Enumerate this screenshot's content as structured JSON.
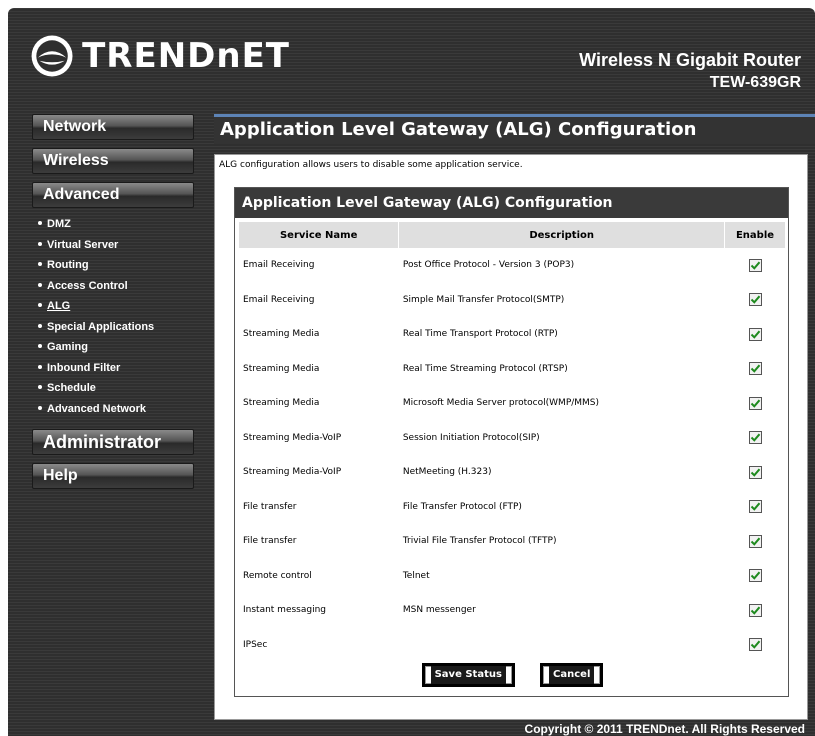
{
  "header": {
    "brand": "TRENDnET",
    "product": "Wireless N Gigabit Router",
    "model": "TEW-639GR"
  },
  "sidebar": {
    "network": "Network",
    "wireless": "Wireless",
    "advanced": "Advanced",
    "sub_items": [
      {
        "label": "DMZ"
      },
      {
        "label": "Virtual Server"
      },
      {
        "label": "Routing"
      },
      {
        "label": "Access Control"
      },
      {
        "label": "ALG"
      },
      {
        "label": "Special Applications"
      },
      {
        "label": "Gaming"
      },
      {
        "label": "Inbound Filter"
      },
      {
        "label": "Schedule"
      },
      {
        "label": "Advanced Network"
      }
    ],
    "administrator": "Administrator",
    "help": "Help"
  },
  "main": {
    "title": "Application Level Gateway (ALG) Configuration",
    "intro": "ALG configuration allows users to disable some application service.",
    "box_title": "Application Level Gateway (ALG) Configuration",
    "columns": [
      "Service Name",
      "Description",
      "Enable"
    ],
    "rows": [
      {
        "service": "Email Receiving",
        "description": "Post Office Protocol - Version 3 (POP3)",
        "enabled": true
      },
      {
        "service": "Email Receiving",
        "description": "Simple Mail Transfer Protocol(SMTP)",
        "enabled": true
      },
      {
        "service": "Streaming Media",
        "description": "Real Time Transport Protocol (RTP)",
        "enabled": true
      },
      {
        "service": "Streaming Media",
        "description": "Real Time Streaming Protocol (RTSP)",
        "enabled": true
      },
      {
        "service": "Streaming Media",
        "description": "Microsoft Media Server protocol(WMP/MMS)",
        "enabled": true
      },
      {
        "service": "Streaming Media-VoIP",
        "description": "Session Initiation Protocol(SIP)",
        "enabled": true
      },
      {
        "service": "Streaming Media-VoIP",
        "description": "NetMeeting (H.323)",
        "enabled": true
      },
      {
        "service": "File transfer",
        "description": "File Transfer Protocol (FTP)",
        "enabled": true
      },
      {
        "service": "File transfer",
        "description": "Trivial File Transfer Protocol (TFTP)",
        "enabled": true
      },
      {
        "service": "Remote control",
        "description": "Telnet",
        "enabled": true
      },
      {
        "service": "Instant messaging",
        "description": "MSN messenger",
        "enabled": true
      },
      {
        "service": "IPSec",
        "description": "",
        "enabled": true
      }
    ],
    "save_label": "Save Status",
    "cancel_label": "Cancel"
  },
  "footer": {
    "copyright": "Copyright © 2011 TRENDnet. All Rights Reserved"
  },
  "colors": {
    "accent_blue": "#5d84b7",
    "checkmark_green": "#1e8a1e",
    "background_dark": "#333333"
  }
}
